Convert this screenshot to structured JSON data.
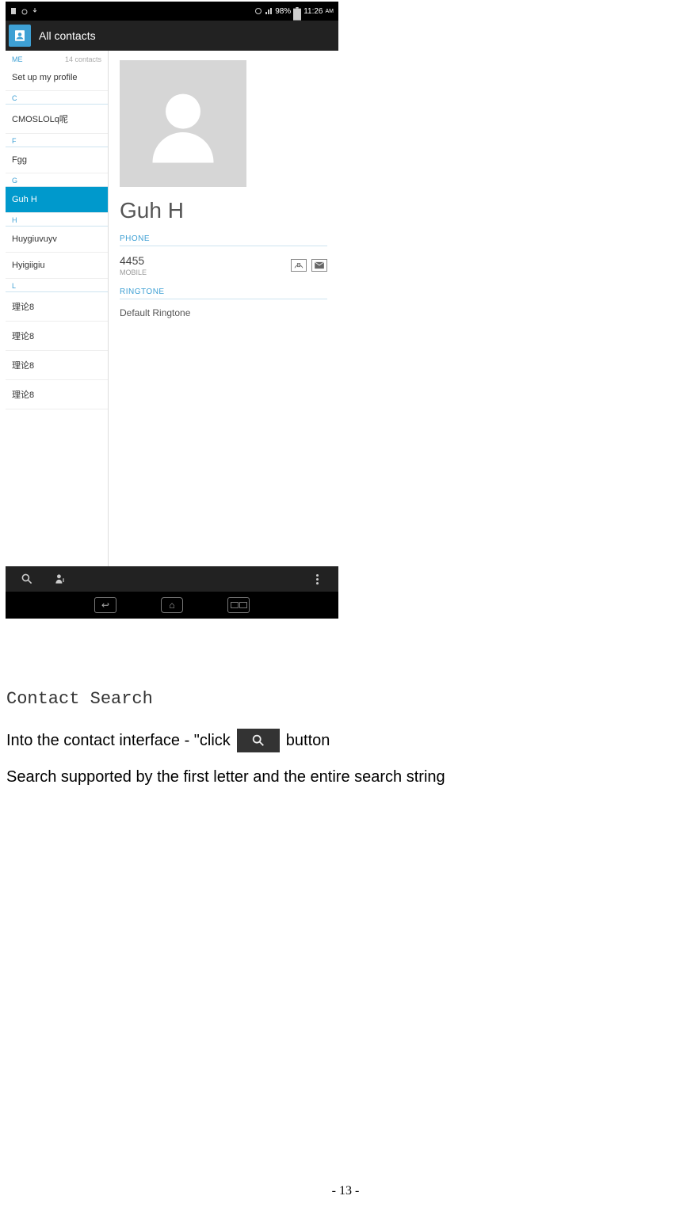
{
  "status_bar": {
    "battery_pct": "98%",
    "time": "11:26",
    "ampm": "AM"
  },
  "app": {
    "title": "All contacts"
  },
  "sidebar": {
    "me_label": "ME",
    "me_count": "14 contacts",
    "setup_profile": "Set up my profile",
    "groups": [
      {
        "letter": "C",
        "items": [
          "CMOSLOLq呢"
        ]
      },
      {
        "letter": "F",
        "items": [
          "Fgg"
        ]
      },
      {
        "letter": "G",
        "items": [
          "Guh H"
        ]
      },
      {
        "letter": "H",
        "items": [
          "Huygiuvuyv",
          "Hyigiigiu"
        ]
      },
      {
        "letter": "L",
        "items": [
          "理论8",
          "理论8",
          "理论8",
          "理论8"
        ]
      }
    ],
    "selected": "Guh H"
  },
  "detail": {
    "name": "Guh H",
    "phone_label": "PHONE",
    "phone_number": "4455",
    "phone_type": "MOBILE",
    "ringtone_label": "RINGTONE",
    "ringtone_value": "Default Ringtone"
  },
  "doc": {
    "heading": "Contact Search",
    "line1a": "Into the contact interface - \"click",
    "line1b": "button",
    "line2": "Search supported by the first letter and the entire search string",
    "page_number": "- 13 -"
  }
}
